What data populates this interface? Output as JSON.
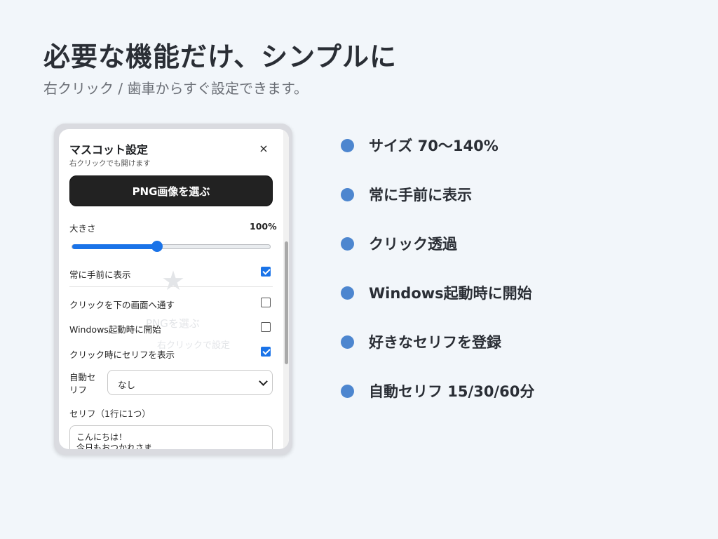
{
  "headline": "必要な機能だけ、シンプルに",
  "subhead": "右クリック / 歯車からすぐ設定できます。",
  "panel": {
    "title": "マスコット設定",
    "subtitle": "右クリックでも開けます",
    "close_glyph": "×",
    "pick_button": "PNG画像を選ぶ",
    "size_label": "大きさ",
    "size_value": "100%",
    "size_fraction": 0.43,
    "rows": [
      {
        "label": "常に手前に表示",
        "checked": true
      },
      {
        "label": "クリックを下の画面へ通す",
        "checked": false
      },
      {
        "label": "Windows起動時に開始",
        "checked": false
      },
      {
        "label": "クリック時にセリフを表示",
        "checked": true
      }
    ],
    "auto_serif_label": "自動セリフ",
    "auto_serif_value": "なし",
    "serif_list_label": "セリフ（1行に1つ）",
    "serif_text": "こんにちは！\n今日もおつかれさま"
  },
  "background_ghost": {
    "star": "★",
    "line1": "PNGを選ぶ",
    "line2": "右クリックで設定"
  },
  "features": [
    "サイズ 70〜140%",
    "常に手前に表示",
    "クリック透過",
    "Windows起動時に開始",
    "好きなセリフを登録",
    "自動セリフ 15/30/60分"
  ],
  "colors": {
    "accent": "#1a73e8",
    "bullet": "#4d86cf",
    "button_dark": "#222222",
    "background": "#f2f6fa"
  },
  "icons": {
    "close": "close-icon",
    "checkbox_checked": "checkmark-icon",
    "select": "chevron-down-icon",
    "bullet": "bullet-dot-icon"
  }
}
